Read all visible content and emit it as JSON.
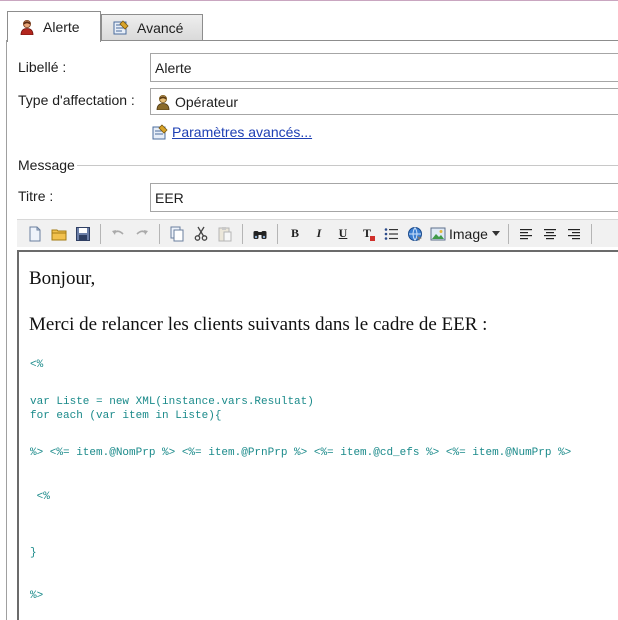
{
  "tabs": [
    {
      "label": "Alerte",
      "icon": "operator-icon",
      "active": true
    },
    {
      "label": "Avancé",
      "icon": "advanced-settings-icon",
      "active": false
    }
  ],
  "form": {
    "libelle_label": "Libellé :",
    "libelle_value": "Alerte",
    "type_label": "Type d'affectation :",
    "type_value": "Opérateur",
    "advanced_link": "Paramètres avancés...",
    "message_section": "Message",
    "titre_label": "Titre :",
    "titre_value": "EER"
  },
  "toolbar": {
    "bold": "B",
    "italic": "I",
    "underline": "U",
    "clear_format": "T",
    "image_label": "Image"
  },
  "editor": {
    "greeting": "Bonjour,",
    "body": "Merci de relancer les clients suivants dans le cadre de EER :",
    "code_lines": [
      "<%",
      "var Liste = new XML(instance.vars.Resultat)",
      "for each (var item in Liste){",
      "%> <%= item.@NomPrp %> <%= item.@PrnPrp %> <%= item.@cd_efs %> <%= item.@NumPrp %>",
      " <%",
      "}",
      "%>"
    ]
  },
  "colors": {
    "link": "#1d3fb4",
    "code": "#1a8a8a"
  }
}
